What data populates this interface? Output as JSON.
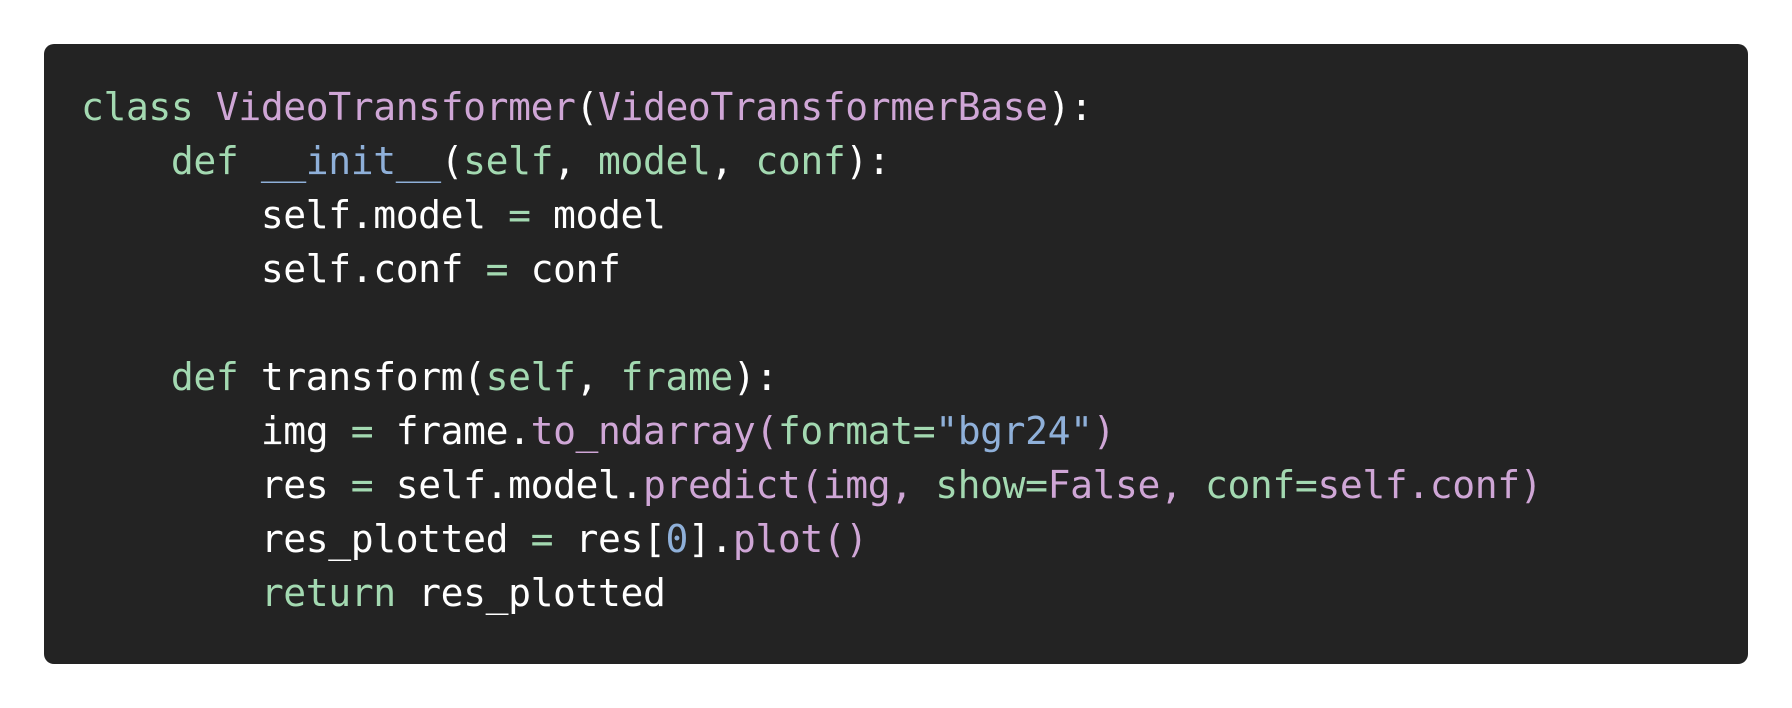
{
  "code_block": {
    "language": "python",
    "background": "#232323",
    "lines": [
      [
        {
          "t": "class ",
          "c": "kw"
        },
        {
          "t": "VideoTransformer",
          "c": "cls"
        },
        {
          "t": "(",
          "c": "plain"
        },
        {
          "t": "VideoTransformerBase",
          "c": "cls"
        },
        {
          "t": "):",
          "c": "plain"
        }
      ],
      [
        {
          "t": "    ",
          "c": "plain"
        },
        {
          "t": "def ",
          "c": "kw"
        },
        {
          "t": "__init__",
          "c": "fn"
        },
        {
          "t": "(",
          "c": "plain"
        },
        {
          "t": "self",
          "c": "param"
        },
        {
          "t": ", ",
          "c": "plain"
        },
        {
          "t": "model",
          "c": "param"
        },
        {
          "t": ", ",
          "c": "plain"
        },
        {
          "t": "conf",
          "c": "param"
        },
        {
          "t": "):",
          "c": "plain"
        }
      ],
      [
        {
          "t": "        self.model ",
          "c": "plain"
        },
        {
          "t": "=",
          "c": "op"
        },
        {
          "t": " model",
          "c": "plain"
        }
      ],
      [
        {
          "t": "        self.conf ",
          "c": "plain"
        },
        {
          "t": "=",
          "c": "op"
        },
        {
          "t": " conf",
          "c": "plain"
        }
      ],
      [],
      [
        {
          "t": "    ",
          "c": "plain"
        },
        {
          "t": "def ",
          "c": "kw"
        },
        {
          "t": "transform(",
          "c": "plain"
        },
        {
          "t": "self",
          "c": "param"
        },
        {
          "t": ", ",
          "c": "plain"
        },
        {
          "t": "frame",
          "c": "param"
        },
        {
          "t": "):",
          "c": "plain"
        }
      ],
      [
        {
          "t": "        img ",
          "c": "plain"
        },
        {
          "t": "=",
          "c": "op"
        },
        {
          "t": " frame.",
          "c": "plain"
        },
        {
          "t": "to_ndarray(",
          "c": "call"
        },
        {
          "t": "format",
          "c": "param"
        },
        {
          "t": "=",
          "c": "op"
        },
        {
          "t": "\"bgr24\"",
          "c": "str"
        },
        {
          "t": ")",
          "c": "call"
        }
      ],
      [
        {
          "t": "        res ",
          "c": "plain"
        },
        {
          "t": "=",
          "c": "op"
        },
        {
          "t": " self.model.",
          "c": "plain"
        },
        {
          "t": "predict(img, ",
          "c": "call"
        },
        {
          "t": "show",
          "c": "param"
        },
        {
          "t": "=",
          "c": "op"
        },
        {
          "t": "False, ",
          "c": "call"
        },
        {
          "t": "conf",
          "c": "param"
        },
        {
          "t": "=",
          "c": "op"
        },
        {
          "t": "self.conf)",
          "c": "call"
        }
      ],
      [
        {
          "t": "        res_plotted ",
          "c": "plain"
        },
        {
          "t": "=",
          "c": "op"
        },
        {
          "t": " res[",
          "c": "plain"
        },
        {
          "t": "0",
          "c": "num"
        },
        {
          "t": "].",
          "c": "plain"
        },
        {
          "t": "plot()",
          "c": "call"
        }
      ],
      [
        {
          "t": "        ",
          "c": "plain"
        },
        {
          "t": "return",
          "c": "kw"
        },
        {
          "t": " res_plotted",
          "c": "plain"
        }
      ]
    ]
  }
}
